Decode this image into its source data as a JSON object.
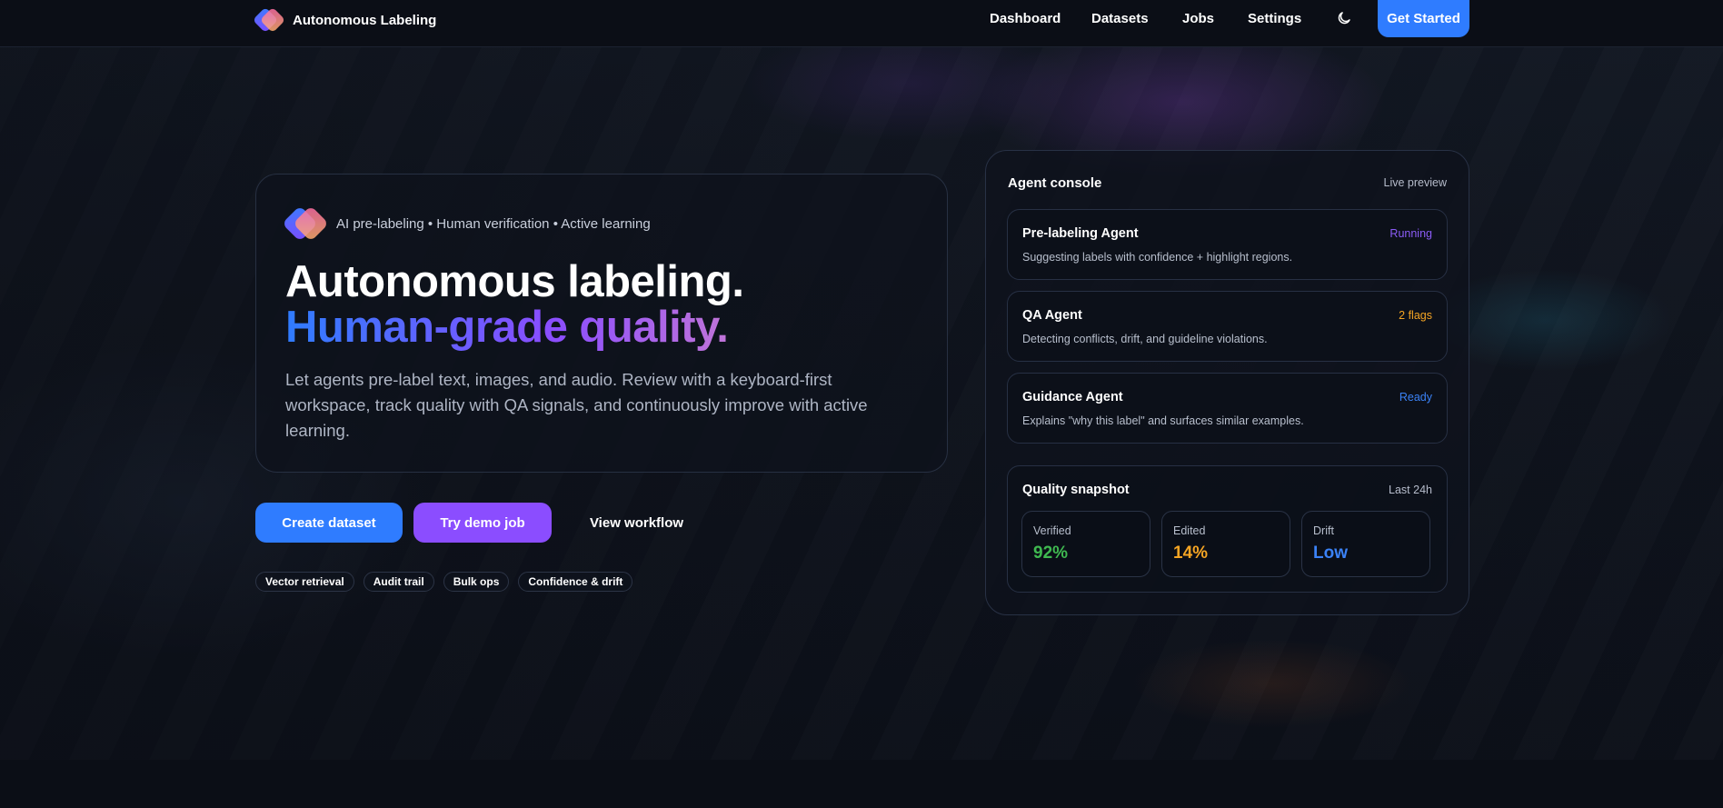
{
  "nav": {
    "brand": "Autonomous Labeling",
    "links": [
      "Dashboard",
      "Datasets",
      "Jobs",
      "Settings"
    ],
    "theme_icon": "moon-icon",
    "cta": "Get Started"
  },
  "hero": {
    "tagline": "AI pre-labeling • Human verification • Active learning",
    "title_line1": "Autonomous labeling.",
    "title_line2": "Human-grade quality.",
    "lede": "Let agents pre-label text, images, and audio. Review with a keyboard-first workspace, track quality with QA signals, and continuously improve with active learning.",
    "buttons": {
      "primary": "Create dataset",
      "secondary": "Try demo job",
      "ghost": "View workflow"
    },
    "chips": [
      "Vector retrieval",
      "Audit trail",
      "Bulk ops",
      "Confidence & drift"
    ]
  },
  "console": {
    "title": "Agent console",
    "meta": "Live preview",
    "agents": [
      {
        "name": "Pre-labeling Agent",
        "status": "Running",
        "status_color": "#8b5cf6",
        "desc": "Suggesting labels with confidence + highlight regions."
      },
      {
        "name": "QA Agent",
        "status": "2 flags",
        "status_color": "#f5a524",
        "desc": "Detecting conflicts, drift, and guideline violations."
      },
      {
        "name": "Guidance Agent",
        "status": "Ready",
        "status_color": "#3b82f6",
        "desc": "Explains \"why this label\" and surfaces similar examples."
      }
    ],
    "snapshot": {
      "title": "Quality snapshot",
      "meta": "Last 24h",
      "metrics": [
        {
          "label": "Verified",
          "value": "92%",
          "color": "#3fb950"
        },
        {
          "label": "Edited",
          "value": "14%",
          "color": "#f5a524"
        },
        {
          "label": "Drift",
          "value": "Low",
          "color": "#3b82f6"
        }
      ]
    }
  },
  "colors": {
    "accent_blue": "#2f7cff",
    "accent_purple": "#8b4dff",
    "background": "#0b0e16"
  }
}
